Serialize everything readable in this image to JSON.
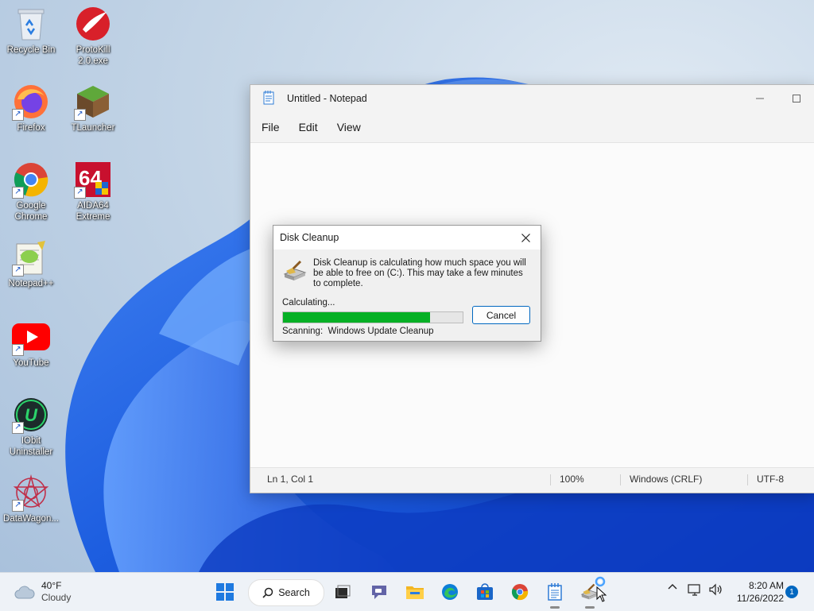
{
  "desktop": {
    "icons": [
      {
        "label": "Recycle Bin",
        "icon": "recycle-bin-icon"
      },
      {
        "label": "ProtoKill 2.0.exe",
        "icon": "protokill-icon"
      },
      {
        "label": "Firefox",
        "icon": "firefox-icon"
      },
      {
        "label": "TLauncher",
        "icon": "tlauncher-icon"
      },
      {
        "label": "Google Chrome",
        "icon": "chrome-icon"
      },
      {
        "label": "AIDA64 Extreme",
        "icon": "aida64-icon"
      },
      {
        "label": "Notepad++",
        "icon": "notepadpp-icon"
      },
      {
        "label": "YouTube",
        "icon": "youtube-icon"
      },
      {
        "label": "IObit Uninstaller",
        "icon": "iobit-icon"
      },
      {
        "label": "DataWagon...",
        "icon": "datawagon-icon"
      }
    ]
  },
  "notepad": {
    "title": "Untitled - Notepad",
    "menu": [
      "File",
      "Edit",
      "View"
    ],
    "status": {
      "position": "Ln 1, Col 1",
      "zoom": "100%",
      "line_endings": "Windows (CRLF)",
      "encoding": "UTF-8"
    }
  },
  "dialog": {
    "title": "Disk Cleanup",
    "message": "Disk Cleanup is calculating how much space you will be able to free on  (C:). This may take a few minutes to complete.",
    "calculating": "Calculating...",
    "progress": 0.82,
    "cancel_label": "Cancel",
    "scanning_label": "Scanning:",
    "scanning_item": "Windows Update Cleanup"
  },
  "taskbar": {
    "weather_temp": "40°F",
    "weather_desc": "Cloudy",
    "search_label": "Search",
    "apps": [
      "start-icon",
      "task-view-icon",
      "teams-chat-icon",
      "file-explorer-icon",
      "edge-icon",
      "store-icon",
      "chrome-icon",
      "notepad-icon",
      "disk-cleanup-icon"
    ],
    "time": "8:20 AM",
    "date": "11/26/2022",
    "notification_count": "1"
  },
  "colors": {
    "accent": "#0067c0",
    "progress": "#06b025",
    "wallpaper_blue": "#1f5fe0"
  }
}
